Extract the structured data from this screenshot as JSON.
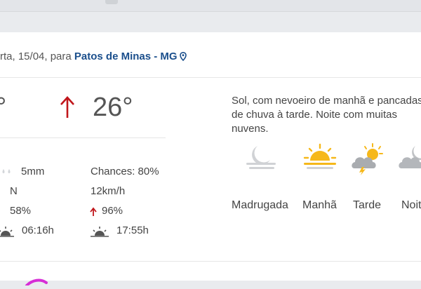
{
  "header": {
    "day_date_prefix": "rta, 15/04, para ",
    "city": "Patos de Minas - MG",
    "pin_icon": "location-pin-icon"
  },
  "temps": {
    "min_fragment": "°",
    "max": "26°",
    "max_color": "#c0161b"
  },
  "stats": {
    "rain_amount": "5mm",
    "rain_chance": "Chances: 80%",
    "wind_direction": "N",
    "wind_speed": "12km/h",
    "humidity_min": "58%",
    "humidity_max": "96%",
    "sunrise": "06:16h",
    "sunset": "17:55h"
  },
  "description": "Sol, com nevoeiro de manhã e pancadas de chuva à tarde. Noite com muitas nuvens.",
  "periods": [
    {
      "label": "Madrugada",
      "icon": "moon-fog-icon"
    },
    {
      "label": "Manhã",
      "icon": "sun-fog-icon"
    },
    {
      "label": "Tarde",
      "icon": "sun-storm-cloud-icon"
    },
    {
      "label": "Noite",
      "icon": "moon-cloud-icon"
    }
  ],
  "colors": {
    "city_blue": "#1b4f8c",
    "sun_yellow": "#f6b81a",
    "cloud_grey": "#c7c9cc"
  }
}
